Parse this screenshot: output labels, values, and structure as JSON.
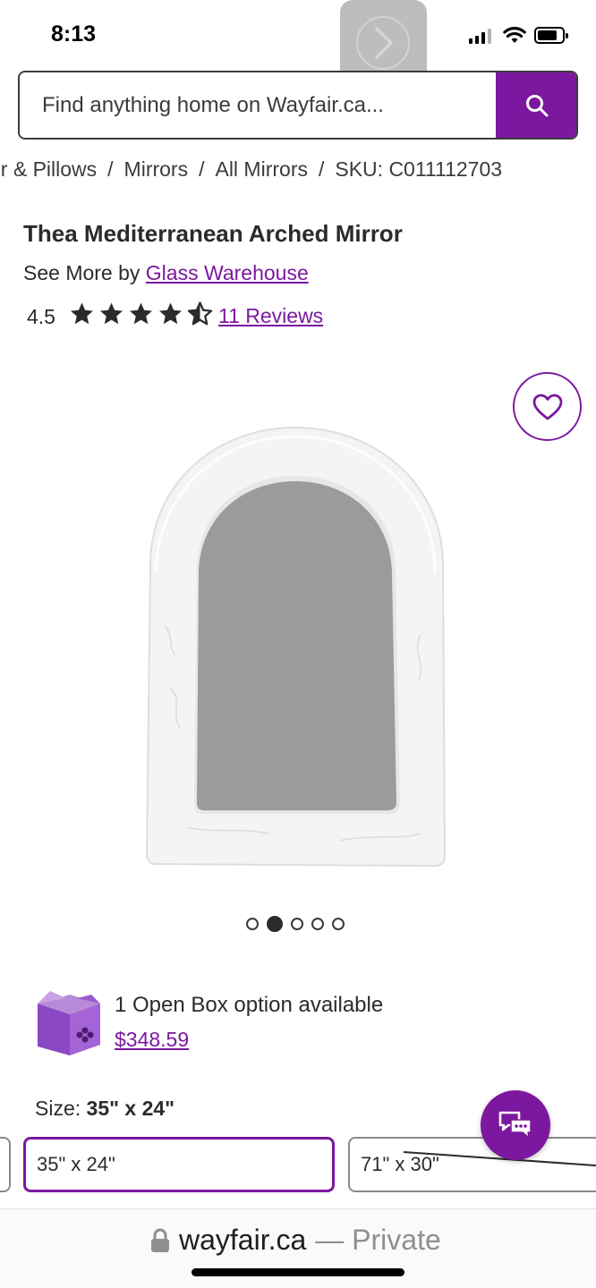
{
  "status_bar": {
    "time": "8:13"
  },
  "search": {
    "placeholder": "Find anything home on Wayfair.ca...",
    "button_icon": "search-icon"
  },
  "breadcrumb": {
    "items": [
      "or & Pillows",
      "Mirrors",
      "All Mirrors",
      "SKU: C011112703"
    ],
    "separator": "/"
  },
  "product": {
    "title": "Thea Mediterranean Arched Mirror",
    "see_more_prefix": "See More by",
    "brand": "Glass Warehouse",
    "rating": "4.5",
    "rating_stars": 4.5,
    "reviews_link": "11 Reviews"
  },
  "gallery": {
    "total_images": 5,
    "active_index": 1
  },
  "open_box": {
    "text": "1 Open Box option available",
    "price": "$348.59"
  },
  "size": {
    "label": "Size:",
    "selected": "35\" x 24\"",
    "options": [
      "35\" x 24\"",
      "71\" x 30\""
    ]
  },
  "browser": {
    "domain": "wayfair.ca",
    "mode": "— Private"
  },
  "colors": {
    "accent": "#7b189f",
    "text": "#2b2b2b"
  }
}
